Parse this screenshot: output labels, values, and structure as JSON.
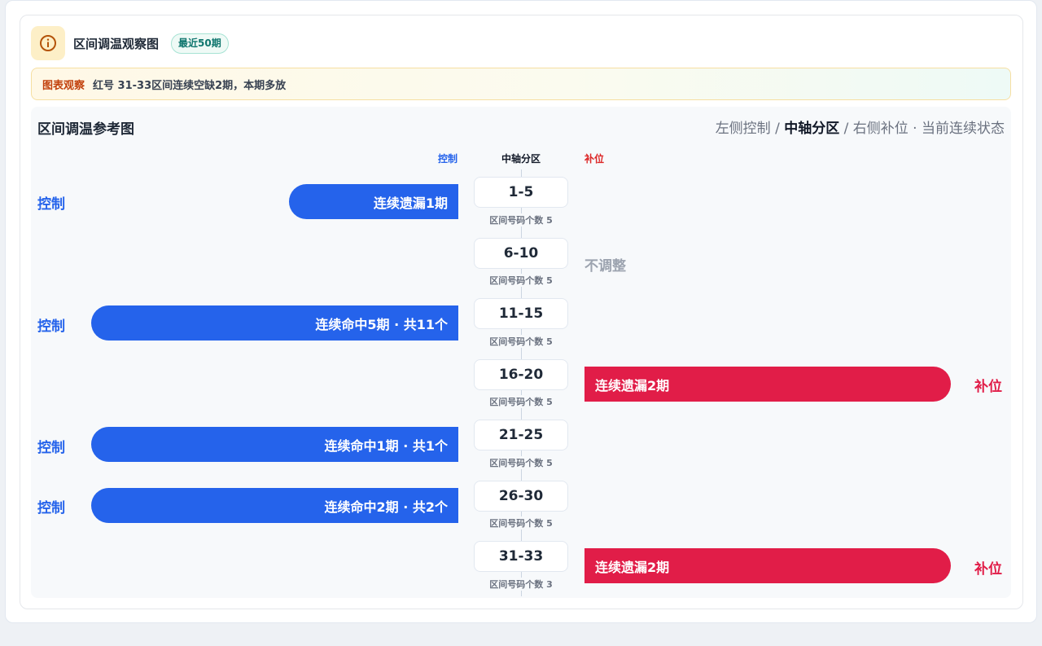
{
  "header": {
    "title": "区间调温观察图",
    "badge": "最近50期"
  },
  "notice": {
    "tag": "图表观察",
    "text": "红号 31-33区间连续空缺2期，本期多放"
  },
  "panel": {
    "title": "区间调温参考图",
    "legend": {
      "left": "左侧控制",
      "sep1": " / ",
      "mid": "中轴分区",
      "sep2": " / ",
      "right": "右侧补位",
      "dot": " · ",
      "state": "当前连续状态"
    }
  },
  "columns": {
    "left": "控制",
    "mid": "中轴分区",
    "right": "补位"
  },
  "rows": [
    {
      "zone": "1-5",
      "count": "区间号码个数 5",
      "side": "left",
      "tag": "控制",
      "bar_text": "连续遗漏1期"
    },
    {
      "zone": "6-10",
      "count": "区间号码个数 5",
      "side": "none",
      "neutral_text": "不调整"
    },
    {
      "zone": "11-15",
      "count": "区间号码个数 5",
      "side": "left",
      "tag": "控制",
      "bar_text": "连续命中5期 · 共11个"
    },
    {
      "zone": "16-20",
      "count": "区间号码个数 5",
      "side": "right",
      "tag": "补位",
      "bar_text": "连续遗漏2期"
    },
    {
      "zone": "21-25",
      "count": "区间号码个数 5",
      "side": "left",
      "tag": "控制",
      "bar_text": "连续命中1期 · 共1个"
    },
    {
      "zone": "26-30",
      "count": "区间号码个数 5",
      "side": "left",
      "tag": "控制",
      "bar_text": "连续命中2期 · 共2个"
    },
    {
      "zone": "31-33",
      "count": "区间号码个数 3",
      "side": "right",
      "tag": "补位",
      "bar_text": "连续遗漏2期"
    }
  ],
  "colors": {
    "control": "#2563eb",
    "fill": "#e11d48",
    "neutral": "#9ca3af"
  }
}
